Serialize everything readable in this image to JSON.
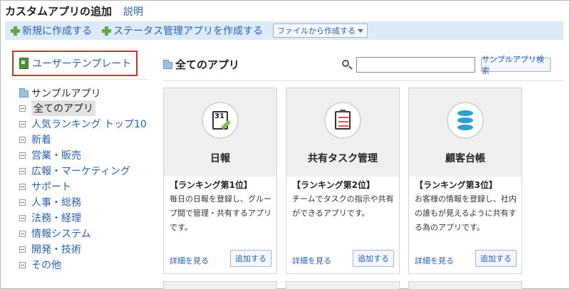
{
  "header": {
    "title": "カスタムアプリの追加",
    "help": "説明"
  },
  "toolbar": {
    "new_app": "新規に作成する",
    "status_app": "ステータス管理アプリを作成する",
    "from_file": "ファイルから作成する"
  },
  "sidebar": {
    "template": "ユーザーテンプレート",
    "tree_root": "サンプルアプリ",
    "items": [
      {
        "label": "全てのアプリ"
      },
      {
        "label": "人気ランキング トップ10"
      },
      {
        "label": "新着"
      },
      {
        "label": "営業・販売"
      },
      {
        "label": "広報・マーケティング"
      },
      {
        "label": "サポート"
      },
      {
        "label": "人事・総務"
      },
      {
        "label": "法務・経理"
      },
      {
        "label": "情報システム"
      },
      {
        "label": "開発・技術"
      },
      {
        "label": "その他"
      }
    ]
  },
  "main": {
    "title": "全てのアプリ",
    "search_value": "",
    "search_button": "サンプルアプリ検索"
  },
  "cards": [
    {
      "icon": "calendar-pencil-icon",
      "name": "日報",
      "rank": "【ランキング第1位】",
      "desc": "毎日の日報を登録し、グループ間で管理・共有するアプリです。",
      "detail": "詳細を見る",
      "add": "追加する"
    },
    {
      "icon": "clipboard-task-icon",
      "name": "共有タスク管理",
      "rank": "【ランキング第2位】",
      "desc": "チームでタスクの指示や共有ができるアプリです。",
      "detail": "詳細を見る",
      "add": "追加する"
    },
    {
      "icon": "database-icon",
      "name": "顧客台帳",
      "rank": "【ランキング第3位】",
      "desc": "お客様の情報を登録し、社内の誰もが見えるように共有する為のアプリです。",
      "detail": "詳細を見る",
      "add": "追加する"
    }
  ],
  "colors": {
    "link": "#2a62b0",
    "toolbar_bg": "#dcebf7",
    "highlight_border": "#d9302c",
    "plus": "#5aae3c"
  }
}
